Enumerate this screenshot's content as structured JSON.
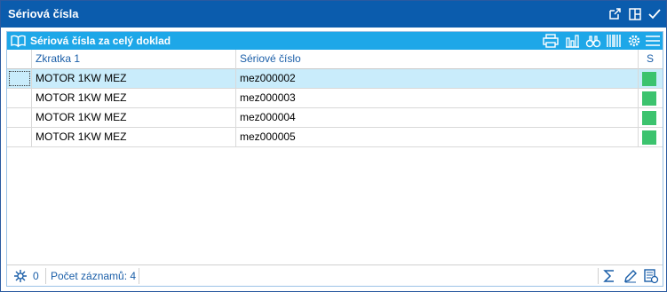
{
  "window": {
    "title": "Sériová čísla"
  },
  "panel": {
    "title": "Sériová čísla za celý doklad"
  },
  "grid": {
    "columns": [
      "Zkratka 1",
      "Sériové číslo",
      "S"
    ],
    "rows": [
      {
        "zkratka": "MOTOR 1KW MEZ",
        "serial": "mez000002",
        "status": "green",
        "selected": true
      },
      {
        "zkratka": "MOTOR 1KW MEZ",
        "serial": "mez000003",
        "status": "green",
        "selected": false
      },
      {
        "zkratka": "MOTOR 1KW MEZ",
        "serial": "mez000004",
        "status": "green",
        "selected": false
      },
      {
        "zkratka": "MOTOR 1KW MEZ",
        "serial": "mez000005",
        "status": "green",
        "selected": false
      }
    ]
  },
  "footer": {
    "filter_count": "0",
    "records_label": "Počet záznamů: 4"
  },
  "colors": {
    "titlebar": "#0b5cad",
    "panel_header": "#1ea7e8",
    "selected_row": "#c9ecfb",
    "status_green": "#3cc36e",
    "link_blue": "#1a5ea8"
  },
  "icons": {
    "titlebar": [
      "popout-icon",
      "maximize-icon",
      "confirm-check-icon"
    ],
    "panel": [
      "book-icon",
      "print-icon",
      "chart-icon",
      "binoculars-icon",
      "barcode-icon",
      "settings-icon",
      "menu-icon"
    ],
    "footer": [
      "filter-icon",
      "sum-icon",
      "edit-icon",
      "calculator-icon"
    ]
  }
}
